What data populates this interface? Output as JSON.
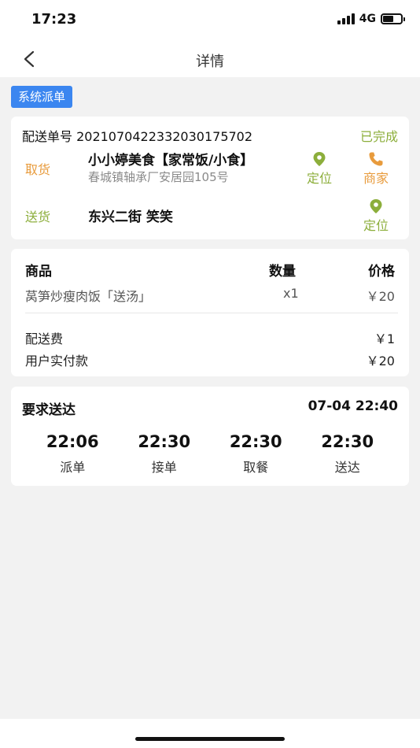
{
  "status_bar": {
    "time": "17:23",
    "network": "4G"
  },
  "nav": {
    "title": "详情"
  },
  "tag": "系统派单",
  "order": {
    "number_text": "配送单号 202107042233203017570​2",
    "status": "已完成",
    "pickup_label": "取货",
    "shop_name": "小小婷美食【家常饭/小食】",
    "shop_address": "春城镇轴承厂安居园105号",
    "locate_label": "定位",
    "merchant_label": "商家",
    "deliver_label": "送货",
    "deliver_address": "东兴二街 笑笑"
  },
  "goods": {
    "header_goods": "商品",
    "header_qty": "数量",
    "header_price": "价格",
    "items": [
      {
        "name": "莴笋炒瘦肉饭「送汤」",
        "qty": "x1",
        "price": "￥20"
      }
    ],
    "fee_label": "配送费",
    "fee_value": "￥1",
    "paid_label": "用户实付款",
    "paid_value": "￥20"
  },
  "delivery": {
    "required_label": "要求送达",
    "required_time": "07-04 22:40",
    "timeline": [
      {
        "time": "22:06",
        "label": "派单"
      },
      {
        "time": "22:30",
        "label": "接单"
      },
      {
        "time": "22:30",
        "label": "取餐"
      },
      {
        "time": "22:30",
        "label": "送达"
      }
    ]
  },
  "colors": {
    "accent_blue": "#3b86f0",
    "status_green": "#8cae3b",
    "pickup_orange": "#e89b3c"
  },
  "battery_level": 0.6
}
